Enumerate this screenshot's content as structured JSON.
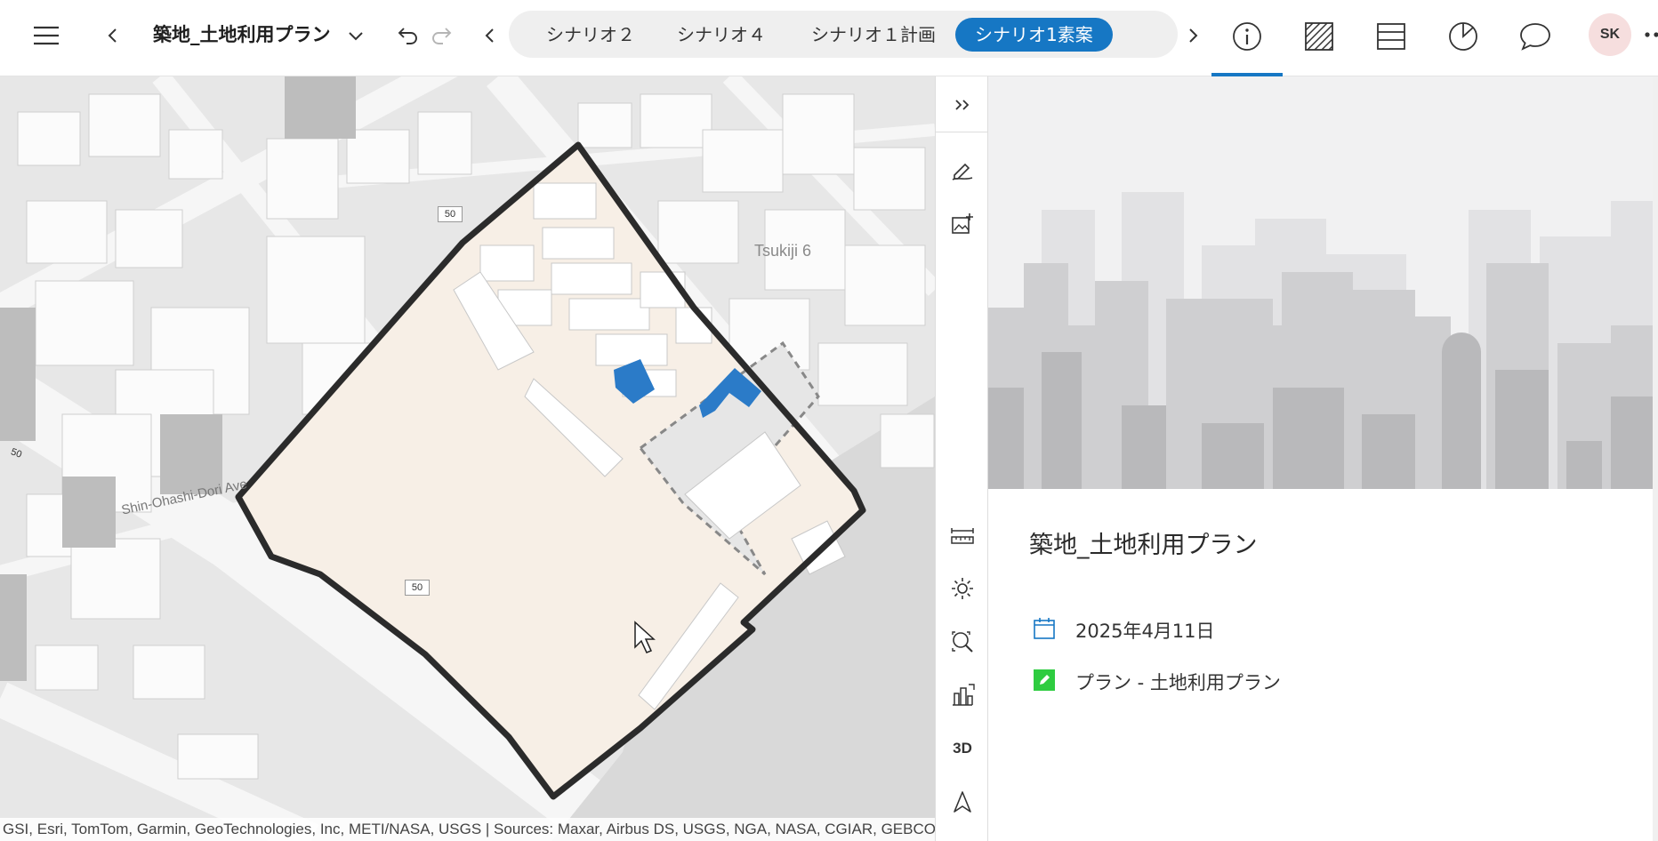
{
  "header": {
    "plan_title": "築地_土地利用プラン",
    "tabs": [
      {
        "label": "シナリオ２",
        "active": false
      },
      {
        "label": "シナリオ４",
        "active": false
      },
      {
        "label": "シナリオ１計画",
        "active": false
      },
      {
        "label": "シナリオ1素案",
        "active": true
      }
    ],
    "user_initials": "SK",
    "icons": {
      "menu": "hamburger-menu-icon",
      "back": "chevron-left-icon",
      "dropdown": "chevron-down-icon",
      "undo": "undo-icon",
      "redo": "redo-icon",
      "tabs_prev": "chevron-left-icon",
      "tabs_more": "more-horizontal-icon",
      "tabs_next": "chevron-right-icon",
      "info": "info-icon",
      "zoning": "hatch-pattern-icon",
      "layers": "table-list-icon",
      "dashboard": "pie-chart-icon",
      "comments": "chat-bubble-icon"
    },
    "accent_color": "#1677c4"
  },
  "map": {
    "attribution": "GSI, Esri, TomTom, Garmin, GeoTechnologies, Inc, METI/NASA, USGS | Sources: Maxar, Airbus DS, USGS, NGA, NASA, CGIAR, GEBCO",
    "street_label": "Shin-Ohashi-Dori Ave",
    "district_label": "Tsukiji 6",
    "route_shields": [
      "50",
      "50",
      "50"
    ],
    "plan_fill_color": "#f7efe6",
    "boundary_color": "#2b2b2b",
    "highlight_building_color": "#2b7bc8"
  },
  "toolstrip": {
    "three_d_label": "3D",
    "icons": [
      "expand-double-chevron-icon",
      "sketch-pen-icon",
      "add-image-icon",
      "measure-ruler-icon",
      "daylight-sun-icon",
      "zoom-search-icon",
      "building-chart-icon",
      "navigate-north-arrow-icon"
    ]
  },
  "panel": {
    "title": "築地_土地利用プラン",
    "date": "2025年4月11日",
    "plan_type": "プラン - 土地利用プラン",
    "date_icon": "calendar-icon",
    "plan_icon": "edit-pencil-icon",
    "plan_icon_color": "#2ecc40"
  }
}
